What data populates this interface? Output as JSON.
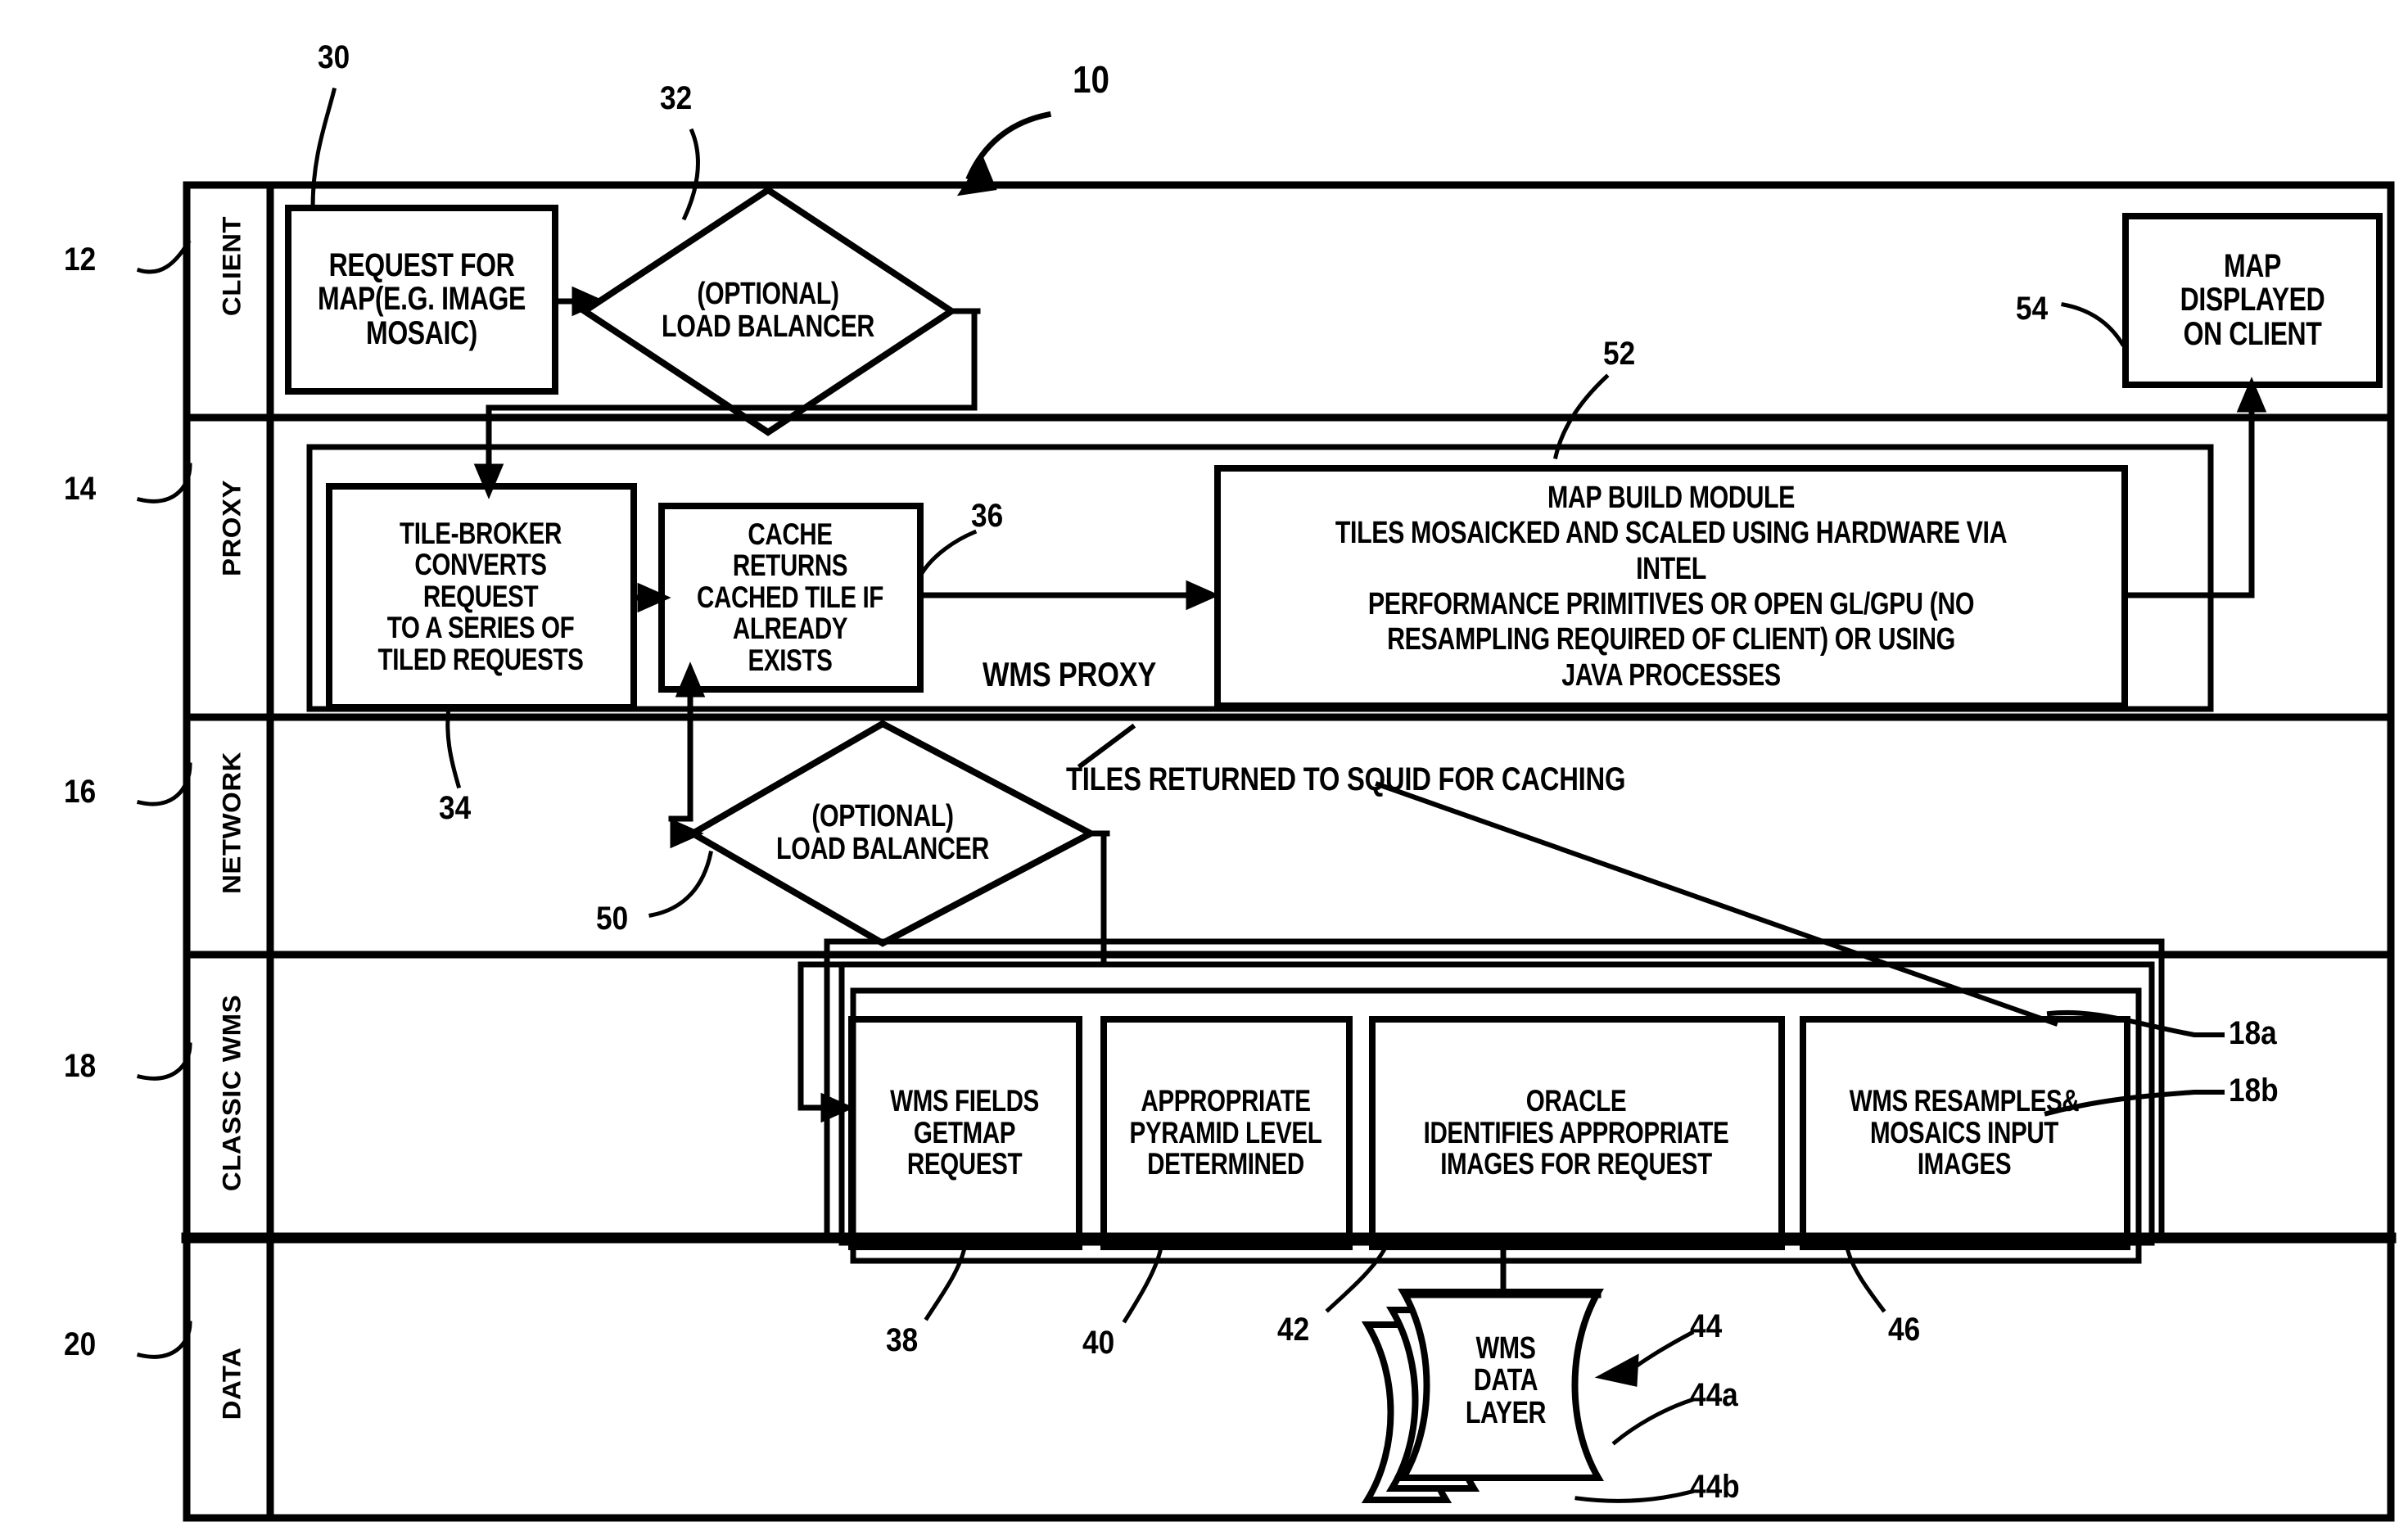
{
  "figure": {
    "number": "10",
    "row_labels": [
      {
        "ref": "12",
        "label": "CLIENT"
      },
      {
        "ref": "14",
        "label": "PROXY"
      },
      {
        "ref": "16",
        "label": "NETWORK"
      },
      {
        "ref": "18",
        "label": "CLASSIC WMS"
      },
      {
        "ref": "20",
        "label": "DATA"
      }
    ]
  },
  "client_row": {
    "request_box": {
      "ref": "30",
      "text": "REQUEST FOR\nMAP(E.G. IMAGE\nMOSAIC)"
    },
    "load_balancer": {
      "ref": "32",
      "text": "(OPTIONAL)\nLOAD BALANCER"
    },
    "map_displayed": {
      "ref": "54",
      "text": "MAP\nDISPLAYED\nON CLIENT"
    }
  },
  "proxy_row": {
    "container_label": "WMS PROXY",
    "tile_broker": {
      "ref": "34",
      "text": "TILE-BROKER\nCONVERTS REQUEST\nTO A SERIES OF\nTILED REQUESTS"
    },
    "cache": {
      "ref": "36",
      "text": "CACHE RETURNS\nCACHED TILE IF\nALREADY EXISTS"
    },
    "map_build_module": {
      "ref": "52",
      "text": "MAP BUILD MODULE\nTILES MOSAICKED AND SCALED USING HARDWARE VIA INTEL\nPERFORMANCE PRIMITIVES OR OPEN GL/GPU (NO\nRESAMPLING REQUIRED OF CLIENT) OR USING\nJAVA PROCESSES"
    }
  },
  "network_row": {
    "load_balancer": {
      "ref": "50",
      "text": "(OPTIONAL)\nLOAD BALANCER"
    },
    "annotation": "TILES RETURNED TO SQUID FOR CACHING"
  },
  "classic_wms_row": {
    "layer_refs": [
      "18a",
      "18b"
    ],
    "boxes": [
      {
        "ref": "38",
        "text": "WMS FIELDS\nGETMAP\nREQUEST"
      },
      {
        "ref": "40",
        "text": "APPROPRIATE\nPYRAMID LEVEL\nDETERMINED"
      },
      {
        "ref": "42",
        "text": "ORACLE\nIDENTIFIES APPROPRIATE\nIMAGES FOR REQUEST"
      },
      {
        "ref": "46",
        "text": "WMS RESAMPLES&\nMOSAICS INPUT\nIMAGES"
      }
    ]
  },
  "data_row": {
    "data_layer": {
      "ref": "44",
      "text": "WMS\nDATA LAYER",
      "sheet_refs": [
        "44a",
        "44b"
      ]
    }
  },
  "colors": {
    "ink": "#000000",
    "paper": "#ffffff"
  }
}
